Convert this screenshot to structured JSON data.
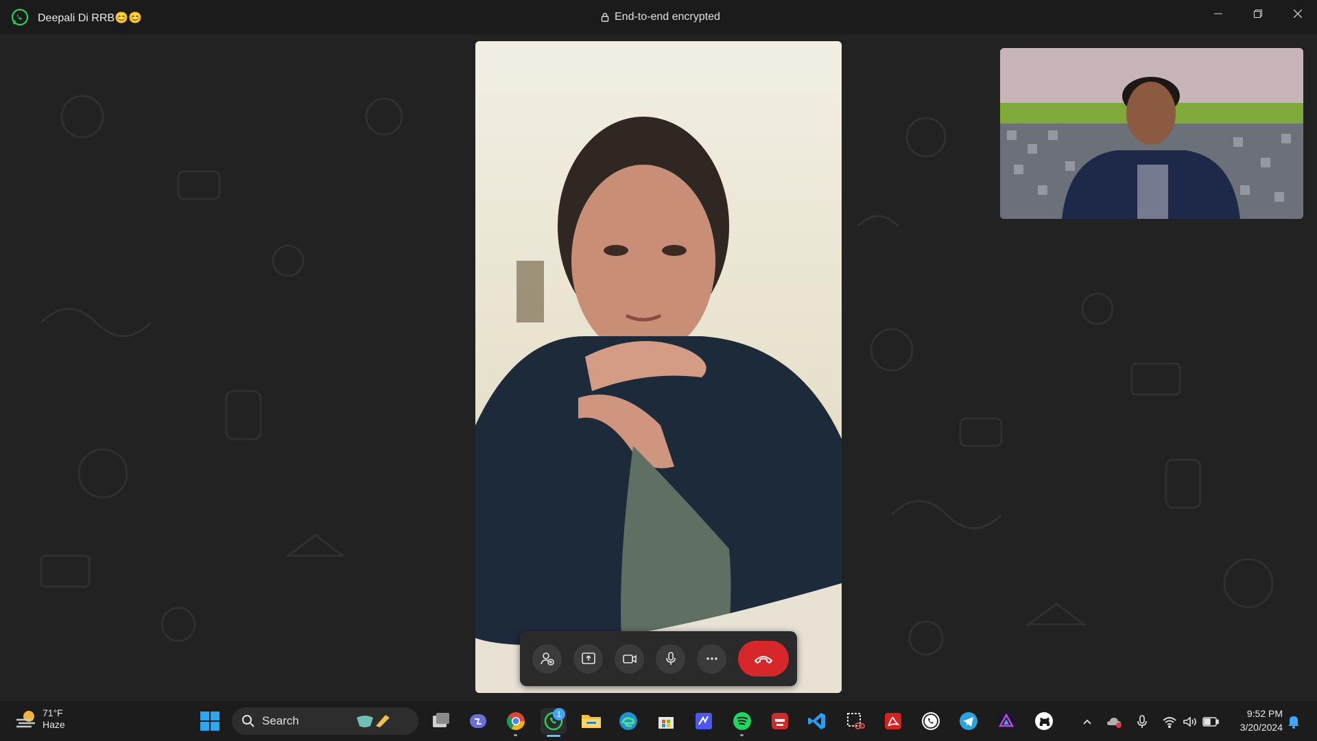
{
  "window": {
    "contact_name": "Deepali Di RRB😊😊",
    "encryption_label": "End-to-end encrypted"
  },
  "call_controls": {
    "buttons": [
      "add-participant",
      "share-screen",
      "camera",
      "microphone",
      "more",
      "end-call"
    ],
    "end_call_color": "#d7272a"
  },
  "taskbar": {
    "weather": {
      "temperature": "71°F",
      "condition": "Haze"
    },
    "search_label": "Search",
    "whatsapp_badge": "1",
    "pinned_apps": [
      "windows-start",
      "search",
      "task-view",
      "teams",
      "chrome",
      "whatsapp",
      "file-explorer",
      "edge",
      "microsoft-store",
      "visual-studio",
      "spotify",
      "dev-cpp",
      "vscode",
      "snipping-tool",
      "adobe-acrobat",
      "whatsapp-web",
      "telegram",
      "affinity",
      "github"
    ],
    "clock": {
      "time": "9:52 PM",
      "date": "3/20/2024"
    }
  },
  "colors": {
    "accent_whatsapp": "#25d366",
    "background": "#222222",
    "taskbar": "#1c1c1c"
  }
}
